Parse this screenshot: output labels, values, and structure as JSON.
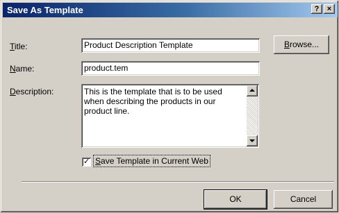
{
  "window": {
    "title": "Save As Template",
    "help_label": "?",
    "close_label": "×"
  },
  "form": {
    "title_label_prefix": "",
    "title_label_hotkey": "T",
    "title_label_rest": "itle:",
    "title_value": "Product Description Template",
    "name_label_hotkey": "N",
    "name_label_rest": "ame:",
    "name_value": "product.tem",
    "description_label_hotkey": "D",
    "description_label_rest": "escription:",
    "description_value": "This is the template that is to be used when describing the products in our product line.",
    "save_in_web_checked": true,
    "save_in_web_hotkey": "S",
    "save_in_web_rest": "ave Template in Current Web"
  },
  "buttons": {
    "browse_hotkey": "B",
    "browse_rest": "rowse...",
    "ok_label": "OK",
    "cancel_label": "Cancel"
  },
  "icons": {
    "checkmark": "checkmark-icon",
    "scroll_up": "arrow-up-icon",
    "scroll_down": "arrow-down-icon"
  }
}
